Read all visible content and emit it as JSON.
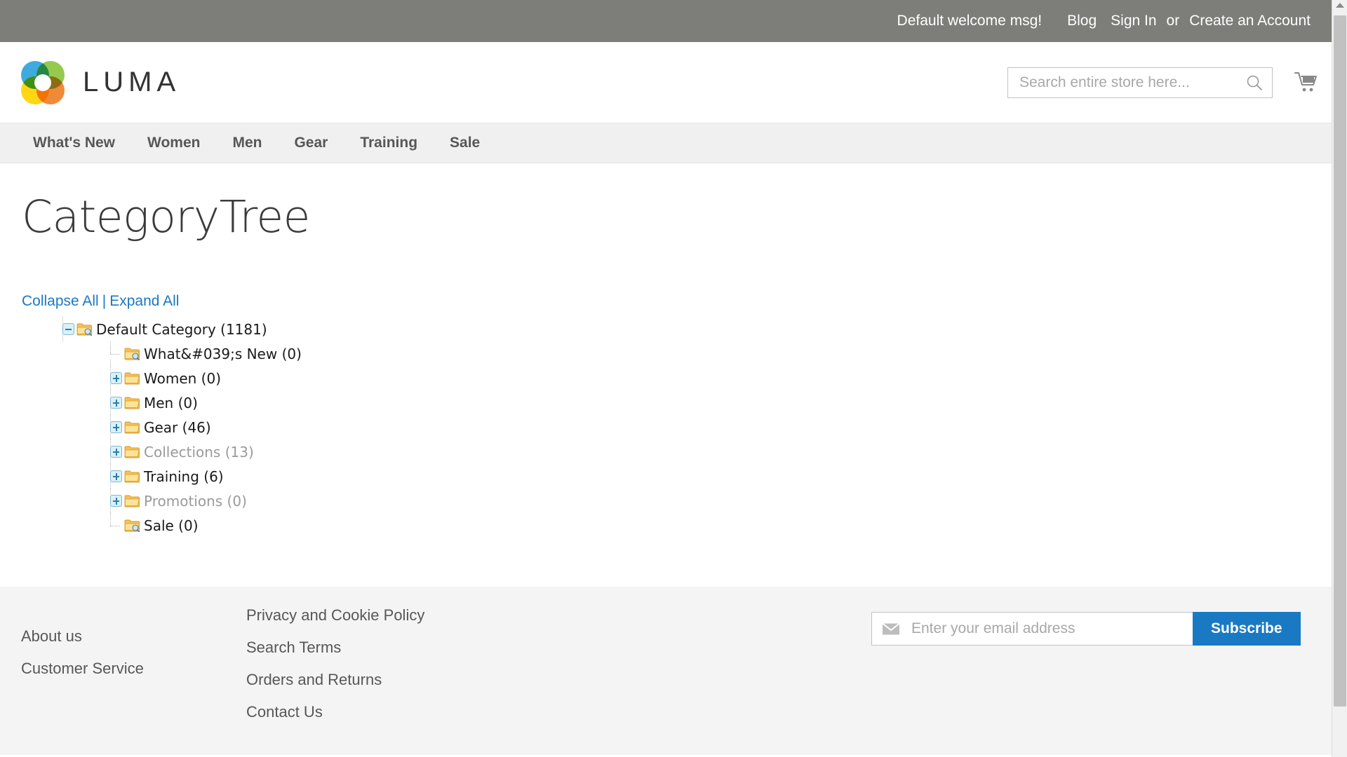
{
  "top_panel": {
    "welcome": "Default welcome msg!",
    "blog": "Blog",
    "sign_in": "Sign In",
    "or": "or",
    "create_account": "Create an Account"
  },
  "header": {
    "logo_text": "LUMA",
    "search": {
      "placeholder": "Search entire store here...",
      "value": ""
    },
    "cart_icon": "shopping-cart-icon",
    "search_icon": "search-icon"
  },
  "nav": {
    "items": [
      {
        "label": "What's New"
      },
      {
        "label": "Women"
      },
      {
        "label": "Men"
      },
      {
        "label": "Gear"
      },
      {
        "label": "Training"
      },
      {
        "label": "Sale"
      }
    ]
  },
  "main": {
    "page_title": "CategoryTree",
    "collapse_all": "Collapse All",
    "separator": "|",
    "expand_all": "Expand All",
    "tree": {
      "root": {
        "label": "Default Category (1181)",
        "toggle": "minus",
        "icon": "folder-search-icon",
        "muted": false
      },
      "children": [
        {
          "label": "What&#039;s New (0)",
          "toggle": "none",
          "icon": "folder-search-icon",
          "muted": false
        },
        {
          "label": "Women (0)",
          "toggle": "plus",
          "icon": "folder-icon",
          "muted": false
        },
        {
          "label": "Men (0)",
          "toggle": "plus",
          "icon": "folder-icon",
          "muted": false
        },
        {
          "label": "Gear (46)",
          "toggle": "plus",
          "icon": "folder-icon",
          "muted": false
        },
        {
          "label": "Collections (13)",
          "toggle": "plus",
          "icon": "folder-icon",
          "muted": true
        },
        {
          "label": "Training (6)",
          "toggle": "plus",
          "icon": "folder-icon",
          "muted": false
        },
        {
          "label": "Promotions (0)",
          "toggle": "plus",
          "icon": "folder-icon",
          "muted": true
        },
        {
          "label": "Sale (0)",
          "toggle": "none",
          "icon": "folder-search-icon",
          "muted": false
        }
      ]
    }
  },
  "footer": {
    "column_a": [
      {
        "label": "About us"
      },
      {
        "label": "Customer Service"
      }
    ],
    "column_b": [
      {
        "label": "Privacy and Cookie Policy"
      },
      {
        "label": "Search Terms"
      },
      {
        "label": "Orders and Returns"
      },
      {
        "label": "Contact Us"
      }
    ],
    "newsletter": {
      "placeholder": "Enter your email address",
      "value": "",
      "button_label": "Subscribe",
      "icon": "envelope-icon"
    }
  },
  "colors": {
    "top_panel_bg": "#7d7d7a",
    "nav_bg": "#f0f0f0",
    "footer_bg": "#f4f4f4",
    "link_blue": "#1979c3",
    "text_dark": "#575757",
    "muted_text": "#9a9a9a"
  }
}
